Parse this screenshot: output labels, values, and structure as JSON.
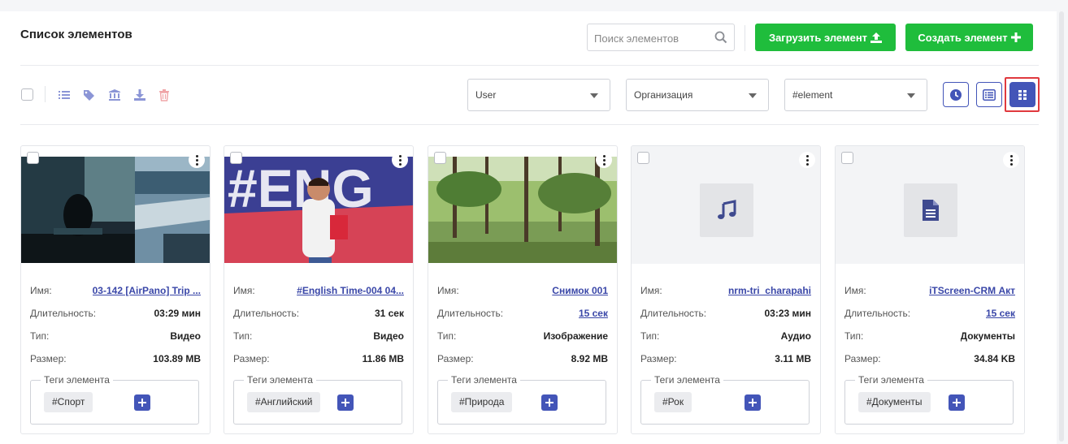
{
  "header": {
    "title": "Список элементов",
    "search_placeholder": "Поиск элементов",
    "upload_label": "Загрузить элемент",
    "create_label": "Создать элемент"
  },
  "filters": {
    "user": "User",
    "organization": "Организация",
    "tag": "#element"
  },
  "colors": {
    "primary": "#4355b8",
    "success": "#1fbd3c",
    "danger": "#e0393e"
  },
  "card_labels": {
    "name": "Имя:",
    "duration": "Длительность:",
    "type": "Тип:",
    "size": "Размер:",
    "tags_legend": "Теги элемента"
  },
  "cards": [
    {
      "name": "03-142 [AirPano] Trip ...",
      "duration": "03:29 мин",
      "type": "Видео",
      "size": "103.89 MB",
      "tag": "#Спорт",
      "thumb": "video-collage"
    },
    {
      "name": "#English Time-004 04...",
      "duration": "31 сек",
      "type": "Видео",
      "size": "11.86 MB",
      "tag": "#Английский",
      "thumb": "video-english"
    },
    {
      "name": "Снимок 001",
      "duration": "15 сек",
      "type": "Изображение",
      "size": "8.92 MB",
      "tag": "#Природа",
      "thumb": "forest-photo"
    },
    {
      "name": "nrm-tri_charapahi",
      "duration": "03:23 мин",
      "type": "Аудио",
      "size": "3.11 MB",
      "tag": "#Рок",
      "thumb": "music-icon"
    },
    {
      "name": "iTScreen-CRM Акт",
      "duration": "15 сек",
      "type": "Документы",
      "size": "34.84 KB",
      "tag": "#Документы",
      "thumb": "document-icon"
    }
  ]
}
